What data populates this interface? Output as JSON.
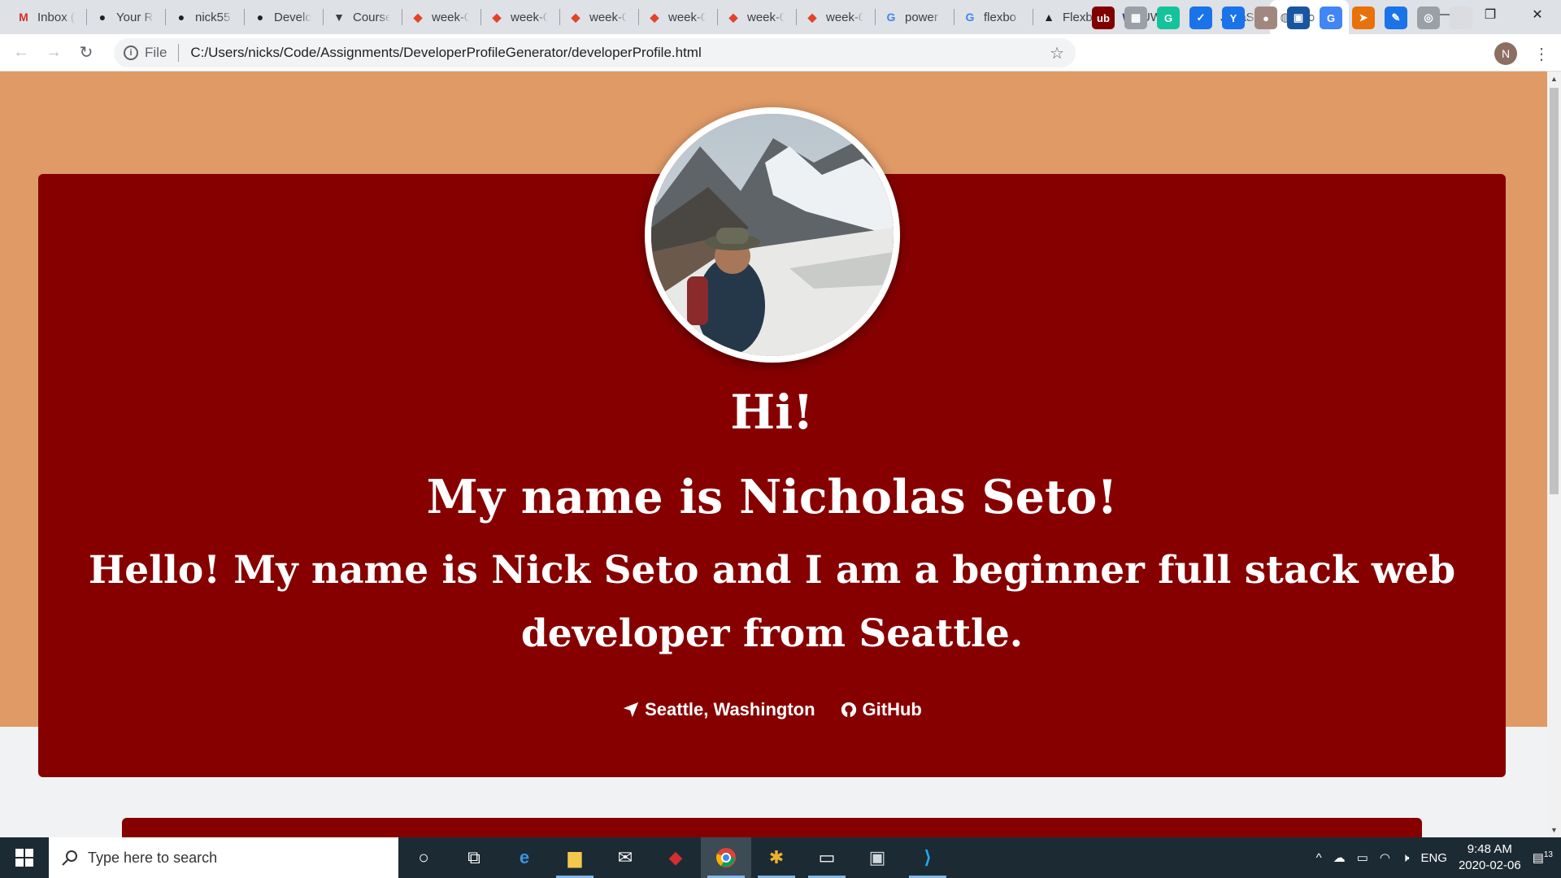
{
  "browser": {
    "tabs": [
      {
        "title": "Inbox (",
        "icon": "gmail-icon",
        "color": "#d93025",
        "glyph": "M"
      },
      {
        "title": "Your Re",
        "icon": "github-icon",
        "color": "#202124",
        "glyph": "●"
      },
      {
        "title": "nick55",
        "icon": "github-icon",
        "color": "#202124",
        "glyph": "●"
      },
      {
        "title": "Develo",
        "icon": "github-icon",
        "color": "#202124",
        "glyph": "●"
      },
      {
        "title": "Course",
        "icon": "shield-icon",
        "color": "#3c4043",
        "glyph": "▼"
      },
      {
        "title": "week-0",
        "icon": "gitlab-icon",
        "color": "#e24329",
        "glyph": "◆"
      },
      {
        "title": "week-0",
        "icon": "gitlab-icon",
        "color": "#e24329",
        "glyph": "◆"
      },
      {
        "title": "week-0",
        "icon": "gitlab-icon",
        "color": "#e24329",
        "glyph": "◆"
      },
      {
        "title": "week-0",
        "icon": "gitlab-icon",
        "color": "#e24329",
        "glyph": "◆"
      },
      {
        "title": "week-0",
        "icon": "gitlab-icon",
        "color": "#e24329",
        "glyph": "◆"
      },
      {
        "title": "week-0",
        "icon": "gitlab-icon",
        "color": "#e24329",
        "glyph": "◆"
      },
      {
        "title": "power",
        "icon": "google-icon",
        "color": "#4285f4",
        "glyph": "G"
      },
      {
        "title": "flexbo",
        "icon": "google-icon",
        "color": "#4285f4",
        "glyph": "G"
      },
      {
        "title": "Flexbo",
        "icon": "bird-icon",
        "color": "#202124",
        "glyph": "▲"
      },
      {
        "title": "UW Co",
        "icon": "w-icon",
        "color": "#4b2e83",
        "glyph": "W"
      },
      {
        "title": "JavaSc",
        "icon": "x-circle-icon",
        "color": "#202124",
        "glyph": "⊗"
      }
    ],
    "active_tab": {
      "title": "Do",
      "icon": "globe-icon",
      "close": "✕"
    },
    "new_tab": "+",
    "window_controls": {
      "minimize": "—",
      "maximize": "❐",
      "close": "✕"
    },
    "nav": {
      "back": "←",
      "forward": "→",
      "reload": "↻"
    },
    "address": {
      "info": "i",
      "scheme": "File",
      "url": "C:/Users/nicks/Code/Assignments/DeveloperProfileGenerator/developerProfile.html",
      "star": "☆"
    },
    "extensions": [
      {
        "name": "ublock-icon",
        "color": "#800000",
        "glyph": "ub"
      },
      {
        "name": "extension-grid-icon",
        "color": "#9aa0a6",
        "glyph": "▦"
      },
      {
        "name": "grammarly-icon",
        "color": "#15c39a",
        "glyph": "G"
      },
      {
        "name": "checkbox-icon",
        "color": "#1a73e8",
        "glyph": "✓"
      },
      {
        "name": "y-icon",
        "color": "#1a73e8",
        "glyph": "Y"
      },
      {
        "name": "circle-icon",
        "color": "#a1887f",
        "glyph": "●"
      },
      {
        "name": "book-icon",
        "color": "#1a56a0",
        "glyph": "▣"
      },
      {
        "name": "translate-icon",
        "color": "#4285f4",
        "glyph": "G"
      },
      {
        "name": "share-icon",
        "color": "#e8710a",
        "glyph": "➤"
      },
      {
        "name": "eyedropper-icon",
        "color": "#1a73e8",
        "glyph": "✎"
      },
      {
        "name": "ring-icon",
        "color": "#9aa0a6",
        "glyph": "◎"
      },
      {
        "name": "blank-extension-icon",
        "color": "#dadce0",
        "glyph": ""
      }
    ],
    "profile_initial": "N",
    "menu": "⋮"
  },
  "page": {
    "greeting": "Hi!",
    "name_line": "My name is Nicholas Seto!",
    "bio": "Hello! My name is Nick Seto and I am a beginner full stack web developer from Seattle.",
    "location": "Seattle, Washington",
    "github": "GitHub",
    "colors": {
      "hero": "#e09a66",
      "card": "#870000"
    }
  },
  "taskbar": {
    "search_placeholder": "Type here to search",
    "apps": [
      "cortana-icon",
      "task-view-icon",
      "edge-icon",
      "file-explorer-icon",
      "mail-icon",
      "game-icon",
      "chrome-icon",
      "slack-icon",
      "terminal-icon",
      "photos-icon",
      "vscode-icon"
    ],
    "tray": {
      "language": "ENG",
      "time": "9:48 AM",
      "date": "2020-02-06",
      "notifications": "13"
    }
  }
}
